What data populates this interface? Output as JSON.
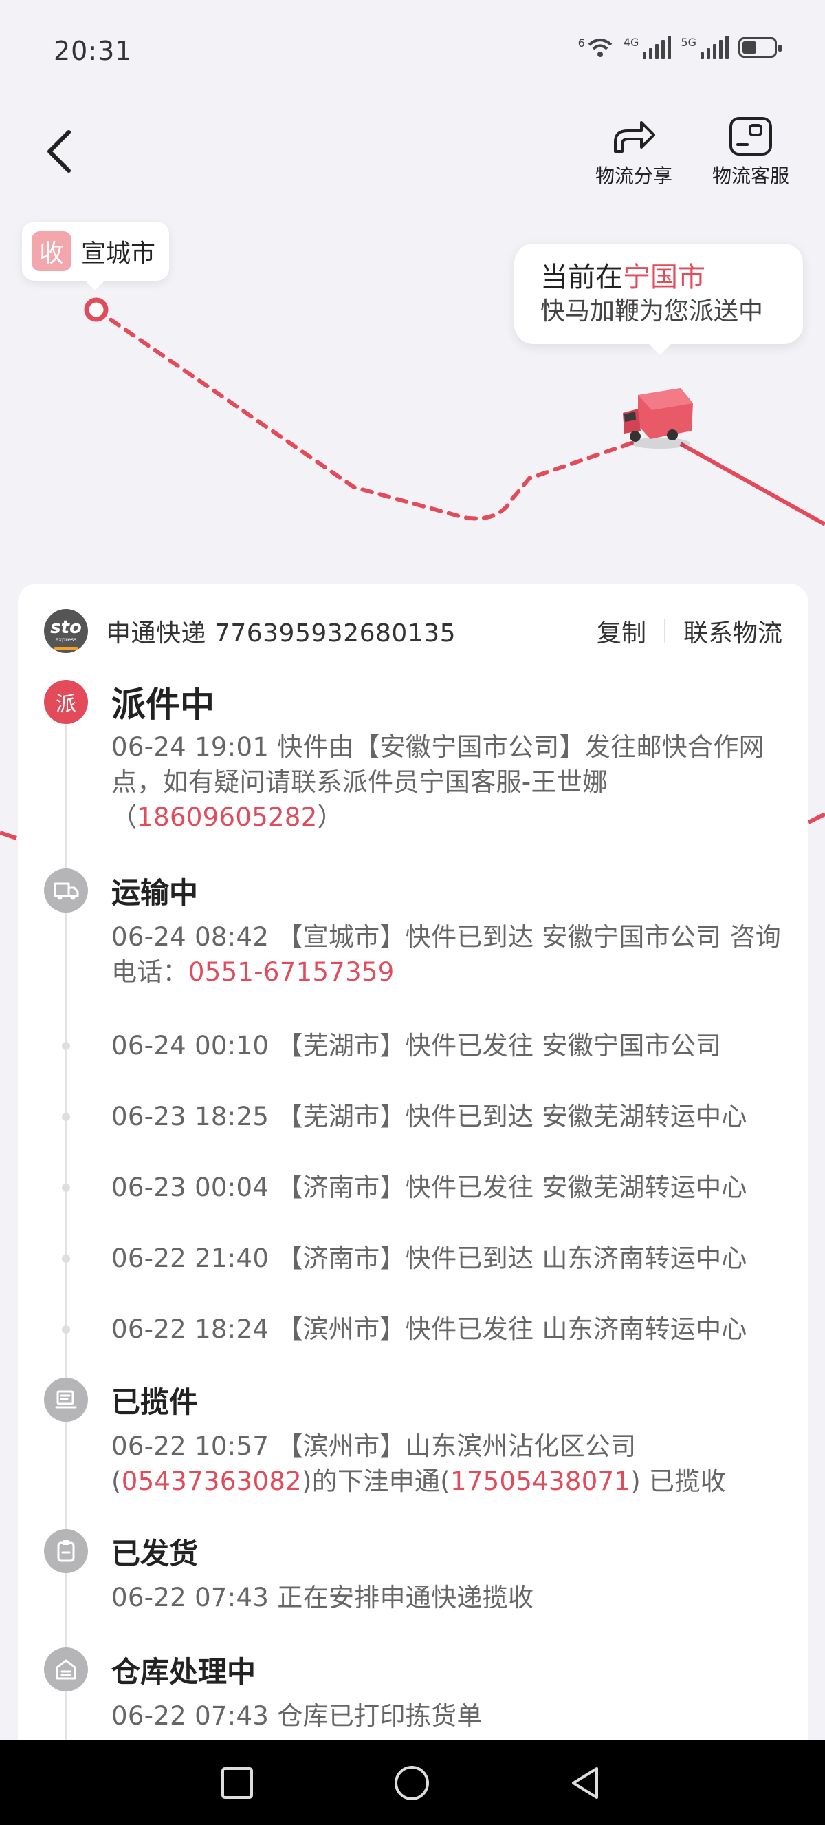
{
  "status": {
    "time": "20:31",
    "wifi_label": "6",
    "net1_label": "4G",
    "net2_label": "5G"
  },
  "header": {
    "share_label": "物流分享",
    "service_label": "物流客服"
  },
  "map": {
    "origin_badge": "收",
    "origin_city": "宣城市",
    "current_prefix": "当前在",
    "current_city": "宁国市",
    "current_sub": "快马加鞭为您派送中"
  },
  "carrier": {
    "logo_text": "sto",
    "logo_sub": "express",
    "name_number": "申通快递 776395932680135",
    "copy_label": "复制",
    "contact_label": "联系物流"
  },
  "timeline": {
    "dispatching": {
      "icon_text": "派",
      "title": "派件中",
      "text_a": "06-24 19:01 快件由【安徽宁国市公司】发往邮快合作网点，如有疑问请联系派件员宁国客服-王世娜（",
      "phone": "18609605282",
      "text_b": "）"
    },
    "transit": {
      "title": "运输中",
      "text_a": "06-24 08:42 【宣城市】快件已到达 安徽宁国市公司 咨询电话：",
      "phone": "0551-67157359",
      "sub_events": [
        "06-24 00:10 【芜湖市】快件已发往 安徽宁国市公司",
        "06-23 18:25 【芜湖市】快件已到达 安徽芜湖转运中心",
        "06-23 00:04 【济南市】快件已发往 安徽芜湖转运中心",
        "06-22 21:40 【济南市】快件已到达 山东济南转运中心",
        "06-22 18:24 【滨州市】快件已发往 山东济南转运中心"
      ]
    },
    "picked_up": {
      "title": "已揽件",
      "text_a": "06-22 10:57 【滨州市】山东滨州沾化区公司(",
      "phone1": "05437363082",
      "text_b": ")的下洼申通(",
      "phone2": "17505438071",
      "text_c": ") 已揽收"
    },
    "shipped": {
      "title": "已发货",
      "text": "06-22 07:43 正在安排申通快递揽收"
    },
    "warehouse": {
      "title": "仓库处理中",
      "text": "06-22 07:43 仓库已打印拣货单"
    }
  },
  "colors": {
    "accent": "#e34b5a",
    "icon_gray": "#b5b5b8",
    "background": "#f3f3f7"
  }
}
